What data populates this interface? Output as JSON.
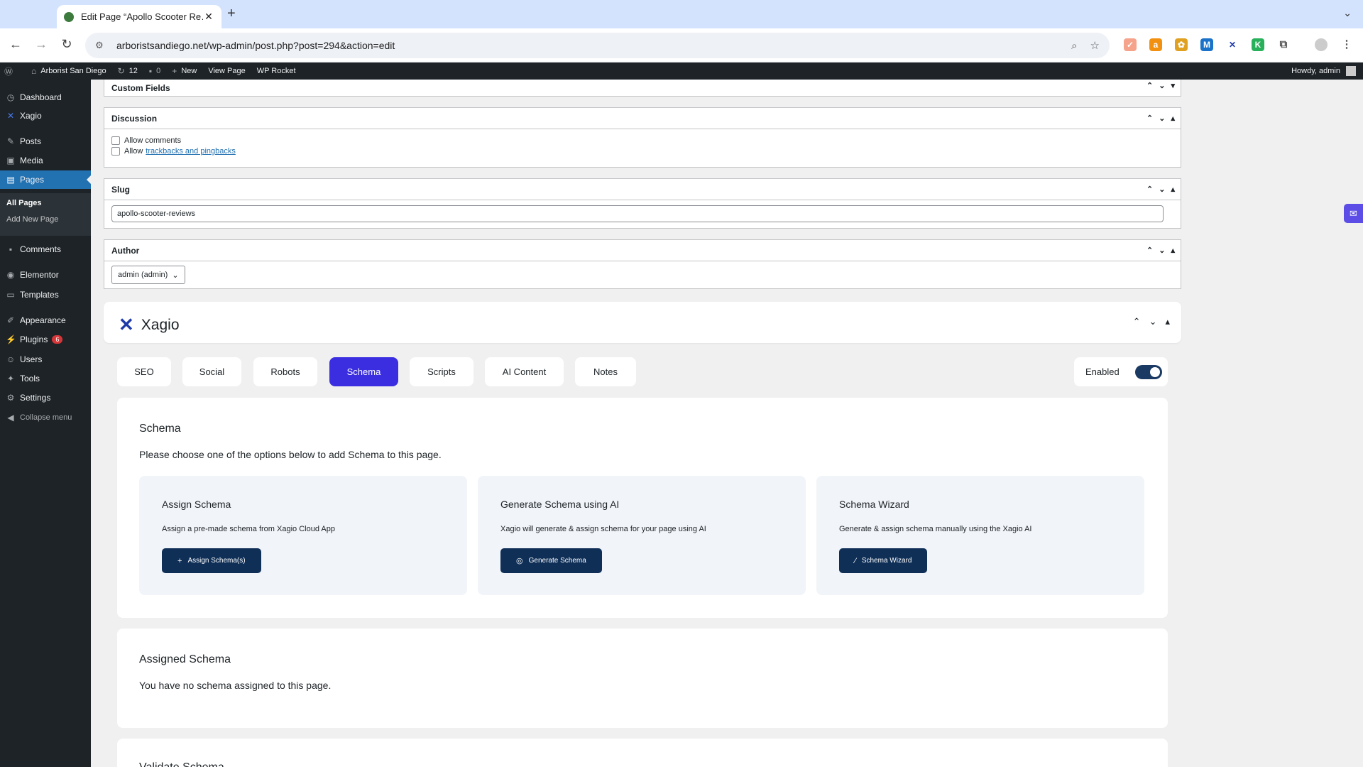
{
  "browser": {
    "tab_title": "Edit Page “Apollo Scooter Re…",
    "tab_close": "✕",
    "new_tab": "+",
    "tab_menu": "⌄",
    "url": "arboristsandiego.net/wp-admin/post.php?post=294&action=edit"
  },
  "adminbar": {
    "site_name": "Arborist San Diego",
    "updates_count": "12",
    "comments_count": "0",
    "new_label": "New",
    "view_page": "View Page",
    "wp_rocket": "WP Rocket",
    "howdy": "Howdy, admin"
  },
  "sidebar": {
    "items": [
      {
        "label": "Dashboard",
        "icon": "dashboard-icon"
      },
      {
        "label": "Xagio",
        "icon": "xagio-icon"
      },
      {
        "label": "Posts",
        "icon": "pin-icon"
      },
      {
        "label": "Media",
        "icon": "media-icon"
      },
      {
        "label": "Pages",
        "icon": "pages-icon"
      },
      {
        "label": "Comments",
        "icon": "comment-icon"
      },
      {
        "label": "Elementor",
        "icon": "elementor-icon"
      },
      {
        "label": "Templates",
        "icon": "folder-icon"
      },
      {
        "label": "Appearance",
        "icon": "brush-icon"
      },
      {
        "label": "Plugins",
        "icon": "plugin-icon"
      },
      {
        "label": "Users",
        "icon": "user-icon"
      },
      {
        "label": "Tools",
        "icon": "wrench-icon"
      },
      {
        "label": "Settings",
        "icon": "settings-icon"
      }
    ],
    "sub_all_pages": "All Pages",
    "sub_add_new": "Add New Page",
    "plugins_badge": "6",
    "collapse": "Collapse menu"
  },
  "boxes": {
    "custom_fields": "Custom Fields",
    "discussion": "Discussion",
    "allow_comments": "Allow comments",
    "allow_prefix": "Allow",
    "trackbacks_link": "trackbacks and pingbacks",
    "slug": "Slug",
    "slug_value": "apollo-scooter-reviews",
    "author": "Author",
    "author_value": "admin (admin)"
  },
  "xagio": {
    "brand": "Xagio",
    "tabs": [
      "SEO",
      "Social",
      "Robots",
      "Schema",
      "Scripts",
      "AI Content",
      "Notes"
    ],
    "active_tab": "Schema",
    "enabled_label": "Enabled",
    "enabled": true,
    "schema_title": "Schema",
    "schema_desc": "Please choose one of the options below to add Schema to this page.",
    "cards": [
      {
        "title": "Assign Schema",
        "desc": "Assign a pre-made schema from Xagio Cloud App",
        "button": "Assign Schema(s)",
        "icon": "plus-icon"
      },
      {
        "title": "Generate Schema using AI",
        "desc": "Xagio will generate & assign schema for your page using AI",
        "button": "Generate Schema",
        "icon": "ai-icon"
      },
      {
        "title": "Schema Wizard",
        "desc": "Generate & assign schema manually using the Xagio AI",
        "button": "Schema Wizard",
        "icon": "wand-icon"
      }
    ],
    "assigned_title": "Assigned Schema",
    "assigned_desc": "You have no schema assigned to this page.",
    "next_section_title": "Validate Schema"
  },
  "colors": {
    "wp_dark": "#1d2327",
    "wp_blue": "#2271b1",
    "xagio_active": "#3b2ee0",
    "xagio_button": "#0f2f57"
  }
}
